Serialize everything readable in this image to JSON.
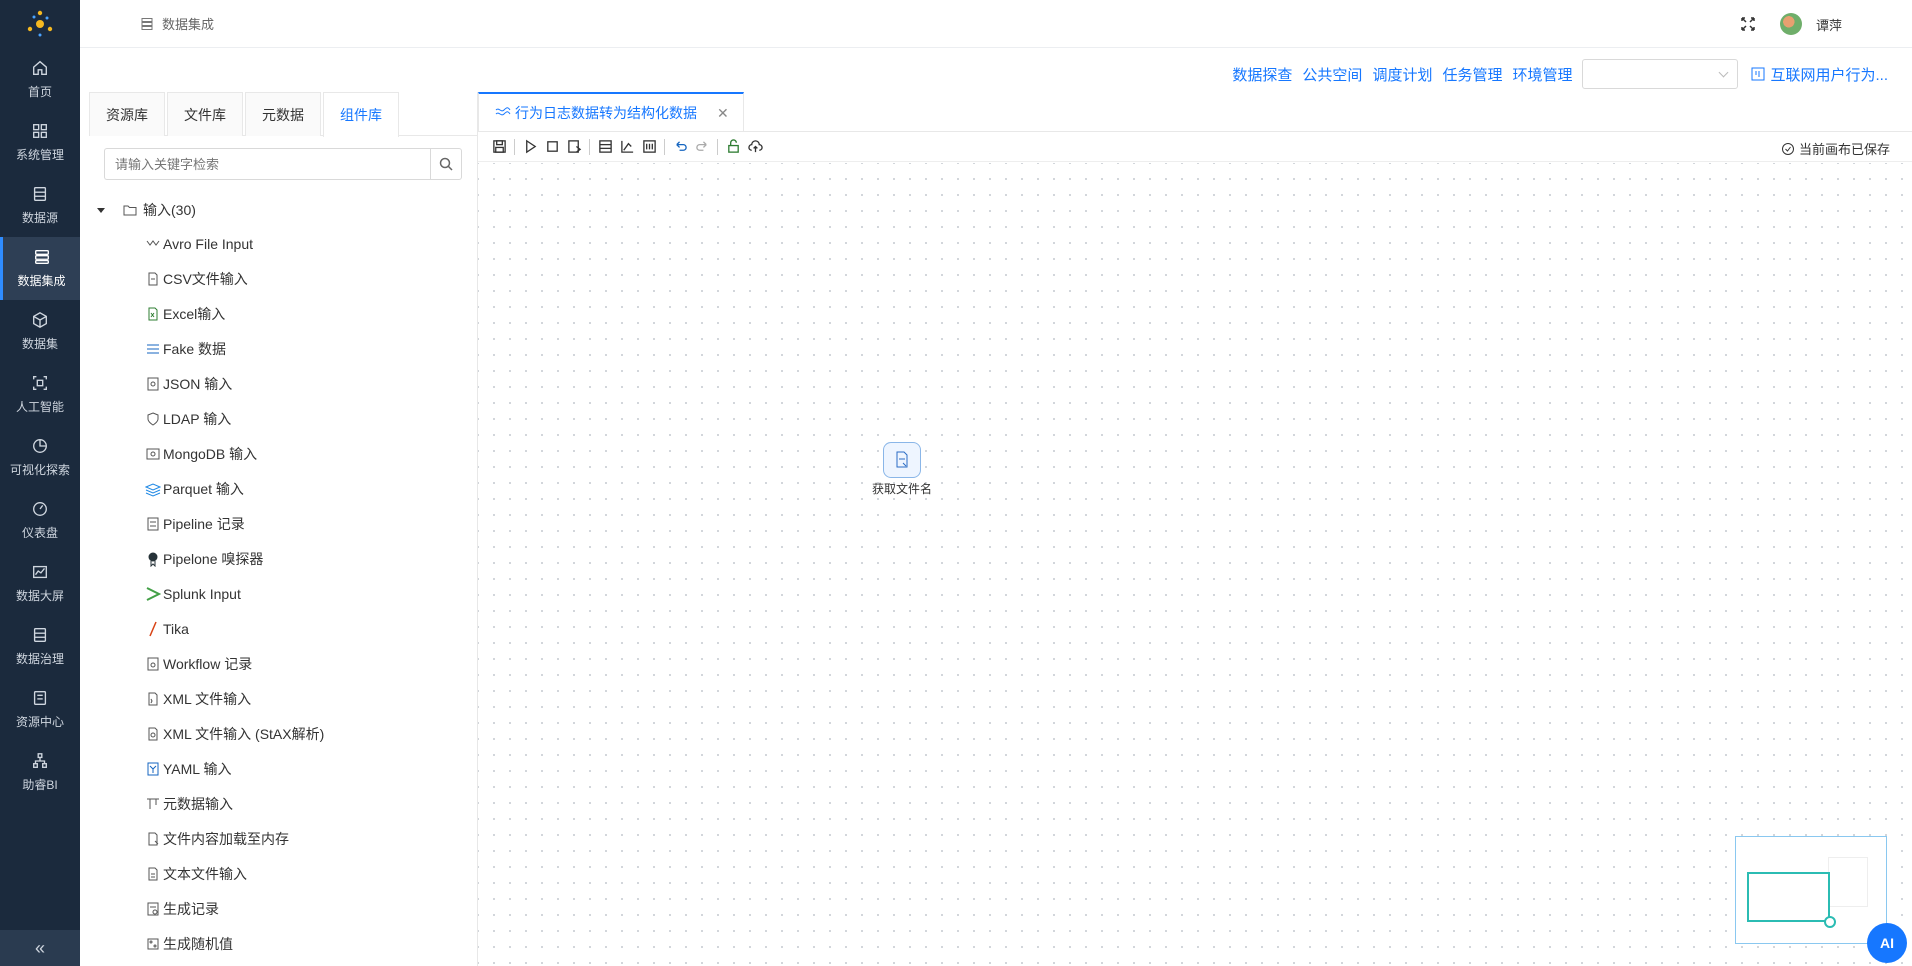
{
  "nav": {
    "items": [
      {
        "label": "首页",
        "icon": "home-icon"
      },
      {
        "label": "系统管理",
        "icon": "grid-icon"
      },
      {
        "label": "数据源",
        "icon": "database-icon"
      },
      {
        "label": "数据集成",
        "icon": "server-icon"
      },
      {
        "label": "数据集",
        "icon": "cube-icon"
      },
      {
        "label": "人工智能",
        "icon": "ai-icon"
      },
      {
        "label": "可视化探索",
        "icon": "pie-icon"
      },
      {
        "label": "仪表盘",
        "icon": "gauge-icon"
      },
      {
        "label": "数据大屏",
        "icon": "chart-icon"
      },
      {
        "label": "数据治理",
        "icon": "list-icon"
      },
      {
        "label": "资源中心",
        "icon": "doc-icon"
      },
      {
        "label": "助睿BI",
        "icon": "org-icon"
      }
    ],
    "collapse": "«"
  },
  "header": {
    "breadcrumb": "数据集成",
    "user": "谭萍"
  },
  "toplinks": [
    "数据探查",
    "公共空间",
    "调度计划",
    "任务管理",
    "环境管理"
  ],
  "project": "互联网用户行为...",
  "panel": {
    "tabs": [
      "资源库",
      "文件库",
      "元数据",
      "组件库"
    ],
    "search_placeholder": "请输入关键字检索",
    "tree_root": "输入(30)",
    "items": [
      "Avro File Input",
      "CSV文件输入",
      "Excel输入",
      "Fake 数据",
      "JSON 输入",
      "LDAP 输入",
      "MongoDB 输入",
      "Parquet 输入",
      "Pipeline 记录",
      "Pipelone 嗅探器",
      "Splunk Input",
      "Tika",
      "Workflow 记录",
      "XML 文件输入",
      "XML 文件输入 (StAX解析)",
      "YAML 输入",
      "元数据输入",
      "文件内容加载至内存",
      "文本文件输入",
      "生成记录",
      "生成随机值"
    ]
  },
  "editor": {
    "tab_title": "行为日志数据转为结构化数据",
    "tab_close": "✕",
    "saved_text": "当前画布已保存",
    "node_label": "获取文件名",
    "ai_label": "AI"
  }
}
